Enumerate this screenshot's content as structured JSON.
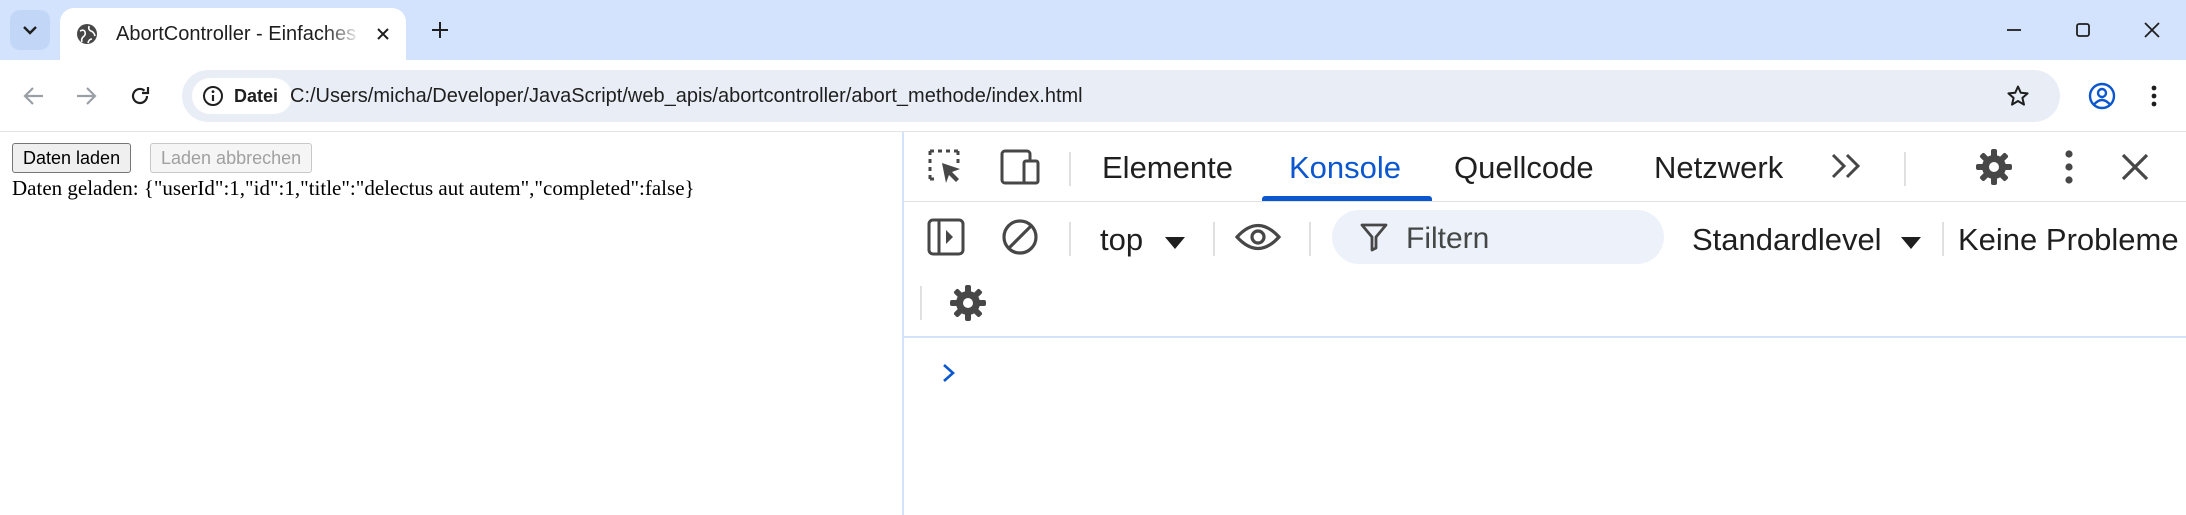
{
  "browser": {
    "tab": {
      "title": "AbortController - Einfaches Fetch"
    },
    "address_bar": {
      "site_info_label": "Datei",
      "url": "C:/Users/micha/Developer/JavaScript/web_apis/abortcontroller/abort_methode/index.html"
    }
  },
  "page": {
    "load_button_label": "Daten laden",
    "abort_button_label": "Laden abbrechen",
    "output_text": "Daten geladen: {\"userId\":1,\"id\":1,\"title\":\"delectus aut autem\",\"completed\":false}"
  },
  "devtools": {
    "tabs": [
      {
        "label": "Elemente",
        "active": false
      },
      {
        "label": "Konsole",
        "active": true
      },
      {
        "label": "Quellcode",
        "active": false
      },
      {
        "label": "Netzwerk",
        "active": false
      }
    ],
    "context_selector": "top",
    "filter_placeholder": "Filtern",
    "log_level": "Standardlevel",
    "issues_label": "Keine Probleme"
  },
  "colors": {
    "accent": "#0b57d0",
    "tabbar": "#d3e3fd",
    "omnibox": "#e9eef6"
  },
  "icons": [
    "tab-search-icon",
    "globe-icon",
    "close-icon",
    "plus-icon",
    "minimize-icon",
    "maximize-icon",
    "back-icon",
    "forward-icon",
    "reload-icon",
    "info-icon",
    "star-icon",
    "profile-icon",
    "kebab-menu-icon",
    "inspect-element-icon",
    "device-toolbar-icon",
    "more-tabs-icon",
    "gear-icon",
    "sidebar-icon",
    "clear-console-icon",
    "eye-icon",
    "filter-icon",
    "dropdown-arrow-icon",
    "prompt-chevron-icon"
  ]
}
